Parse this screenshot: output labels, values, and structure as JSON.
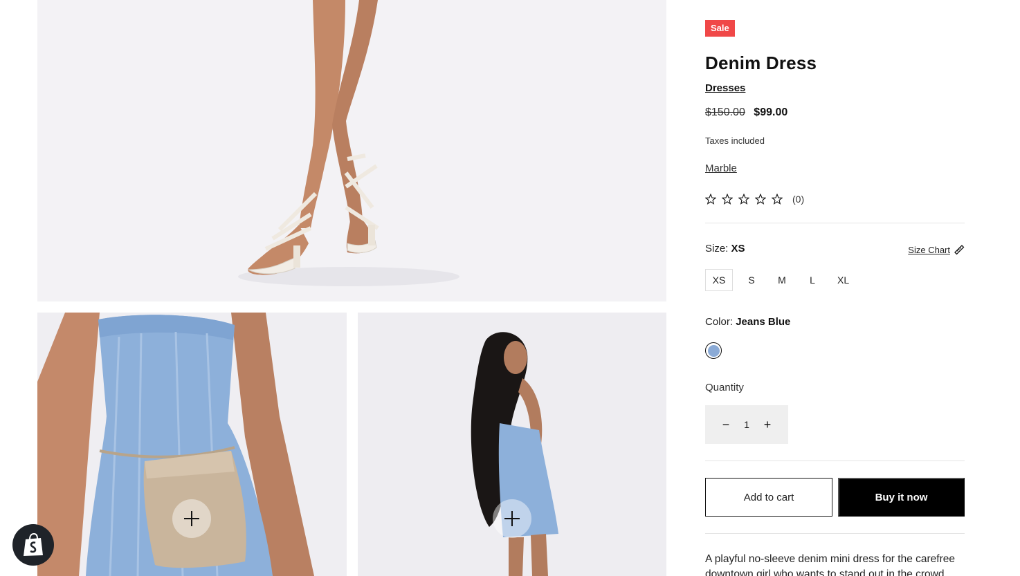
{
  "product": {
    "badge": "Sale",
    "title": "Denim Dress",
    "collection": "Dresses",
    "price_compare": "$150.00",
    "price": "$99.00",
    "taxes_note": "Taxes included",
    "vendor": "Marble",
    "rating": {
      "stars_filled": 0,
      "stars_total": 5,
      "count_text": "(0)"
    },
    "size": {
      "label": "Size:",
      "selected": "XS",
      "chart_link": "Size Chart",
      "options": [
        "XS",
        "S",
        "M",
        "L",
        "XL"
      ]
    },
    "color": {
      "label": "Color:",
      "selected": "Jeans Blue",
      "swatch_color": "#8aaad6"
    },
    "quantity": {
      "label": "Quantity",
      "value": "1",
      "minus": "−",
      "plus": "+"
    },
    "buttons": {
      "add_to_cart": "Add to cart",
      "buy_now": "Buy it now"
    },
    "description": "A playful no-sleeve denim mini dress for the carefree downtown girl who wants to stand out in the crowd."
  },
  "colors": {
    "sale_badge": "#f04848",
    "buy_button": "#000000",
    "denim": "#8fb0d8",
    "skin": "#c98e6c",
    "background": "#ffffff"
  },
  "icons": {
    "zoom": "plus-icon",
    "star": "star-outline-icon",
    "size_chart": "ruler-icon",
    "shop": "shopify-bag-icon"
  }
}
